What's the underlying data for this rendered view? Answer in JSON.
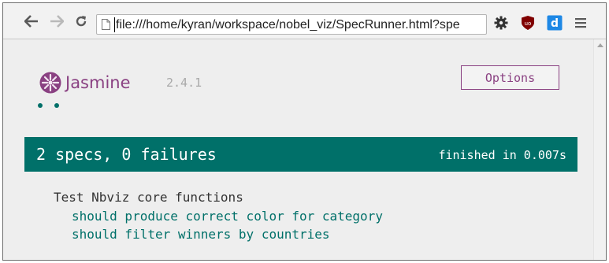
{
  "browser": {
    "url": "file:///home/kyran/workspace/nobel_viz/SpecRunner.html?spe",
    "back_glyph": "🡐",
    "forward_glyph": "🡒",
    "reload_glyph": "↻",
    "menu_glyph": "≡",
    "extensions": [
      {
        "name": "gear-icon"
      },
      {
        "name": "ublock-icon",
        "label": "uo"
      },
      {
        "name": "d-extension-icon",
        "label": "d"
      }
    ]
  },
  "jasmine": {
    "logo_text": "Jasmine",
    "version": "2.4.1",
    "options_label": "Options",
    "dot_count": 2,
    "summary": "2 specs, 0 failures",
    "duration": "finished in 0.007s",
    "suite": "Test Nbviz core functions",
    "specs": [
      "should produce correct color for category",
      "should filter winners by countries"
    ]
  },
  "colors": {
    "passed": "#007069",
    "brand": "#8a4182"
  }
}
